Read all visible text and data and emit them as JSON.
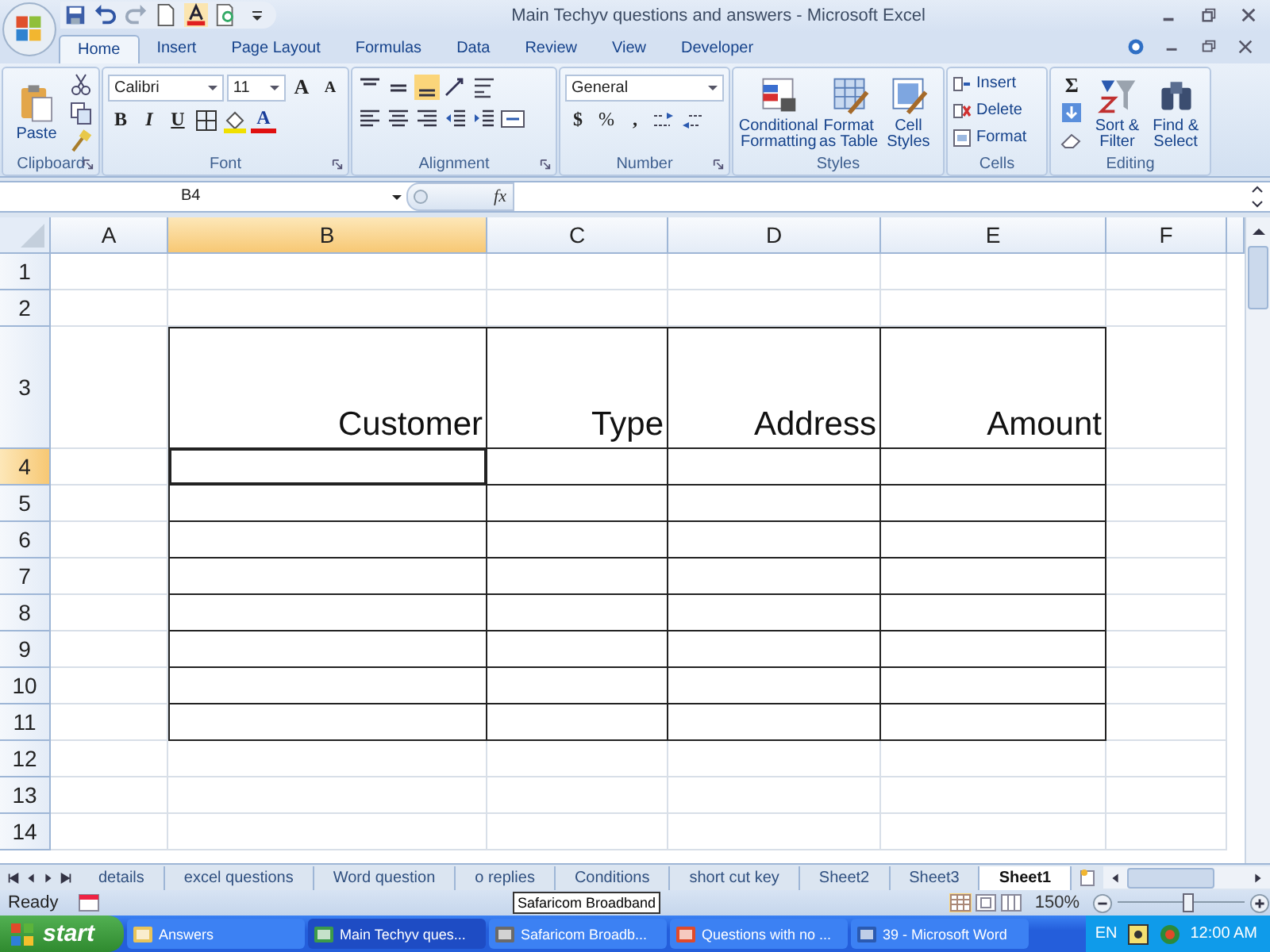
{
  "title_bar": {
    "title": "Main Techyv questions and answers - Microsoft Excel"
  },
  "tabs": [
    {
      "label": "Home",
      "selected": true
    },
    {
      "label": "Insert",
      "selected": false
    },
    {
      "label": "Page Layout",
      "selected": false
    },
    {
      "label": "Formulas",
      "selected": false
    },
    {
      "label": "Data",
      "selected": false
    },
    {
      "label": "Review",
      "selected": false
    },
    {
      "label": "View",
      "selected": false
    },
    {
      "label": "Developer",
      "selected": false
    }
  ],
  "ribbon": {
    "clipboard": {
      "label": "Clipboard",
      "paste": "Paste"
    },
    "font": {
      "label": "Font",
      "font_name": "Calibri",
      "font_size": "11",
      "grow": "A",
      "shrink": "A",
      "bold": "B",
      "italic": "I",
      "underline": "U",
      "font_color": "A"
    },
    "alignment": {
      "label": "Alignment"
    },
    "number": {
      "label": "Number",
      "format": "General",
      "currency": "$",
      "percent": "%",
      "comma": ","
    },
    "styles": {
      "label": "Styles",
      "conditional_formatting": "Conditional Formatting",
      "format_as_table": "Format as Table",
      "cell_styles": "Cell Styles"
    },
    "cells": {
      "label": "Cells",
      "insert": "Insert",
      "delete": "Delete",
      "format": "Format"
    },
    "editing": {
      "label": "Editing",
      "autosum": "Σ",
      "sort_filter": "Sort & Filter",
      "find_select": "Find & Select"
    }
  },
  "formula_bar": {
    "name_box": "B4",
    "function_label": "fx"
  },
  "sheet": {
    "columns": [
      {
        "label": "A",
        "selected": false,
        "in_table": false
      },
      {
        "label": "B",
        "selected": true,
        "in_table": true
      },
      {
        "label": "C",
        "selected": false,
        "in_table": true
      },
      {
        "label": "D",
        "selected": false,
        "in_table": true
      },
      {
        "label": "E",
        "selected": false,
        "in_table": true
      },
      {
        "label": "F",
        "selected": false,
        "in_table": false
      }
    ],
    "rows": [
      {
        "number": "1",
        "selected": false,
        "bordered": false
      },
      {
        "number": "2",
        "selected": false,
        "bordered": false
      },
      {
        "number": "3",
        "selected": false,
        "bordered": true,
        "cells": {
          "B": "Customer",
          "C": "Type",
          "D": "Address",
          "E": "Amount"
        }
      },
      {
        "number": "4",
        "selected": true,
        "bordered": true
      },
      {
        "number": "5",
        "selected": false,
        "bordered": true
      },
      {
        "number": "6",
        "selected": false,
        "bordered": true
      },
      {
        "number": "7",
        "selected": false,
        "bordered": true
      },
      {
        "number": "8",
        "selected": false,
        "bordered": true
      },
      {
        "number": "9",
        "selected": false,
        "bordered": true
      },
      {
        "number": "10",
        "selected": false,
        "bordered": true
      },
      {
        "number": "11",
        "selected": false,
        "bordered": true
      },
      {
        "number": "12",
        "selected": false,
        "bordered": false
      },
      {
        "number": "13",
        "selected": false,
        "bordered": false
      },
      {
        "number": "14",
        "selected": false,
        "bordered": false
      }
    ]
  },
  "sheet_tabs": [
    {
      "label": "details",
      "selected": false
    },
    {
      "label": "excel questions",
      "selected": false
    },
    {
      "label": "Word question",
      "selected": false
    },
    {
      "label": "o replies",
      "selected": false
    },
    {
      "label": "Conditions",
      "selected": false
    },
    {
      "label": "short cut key",
      "selected": false
    },
    {
      "label": "Sheet2",
      "selected": false
    },
    {
      "label": "Sheet3",
      "selected": false
    },
    {
      "label": "Sheet1",
      "selected": true
    }
  ],
  "status_bar": {
    "status": "Ready",
    "zoom": "150%",
    "zoom_slider": {
      "level": 0.55
    }
  },
  "tooltip": "Safaricom Broadband",
  "taskbar": {
    "start": "start",
    "items": [
      {
        "label": "Answers",
        "selected": false
      },
      {
        "label": "Main Techyv ques...",
        "selected": true
      },
      {
        "label": "Safaricom Broadb...",
        "selected": false
      },
      {
        "label": "Questions with no ...",
        "selected": false
      },
      {
        "label": "39 - Microsoft Word",
        "selected": false
      }
    ],
    "language": "EN",
    "clock": "12:00 AM"
  }
}
